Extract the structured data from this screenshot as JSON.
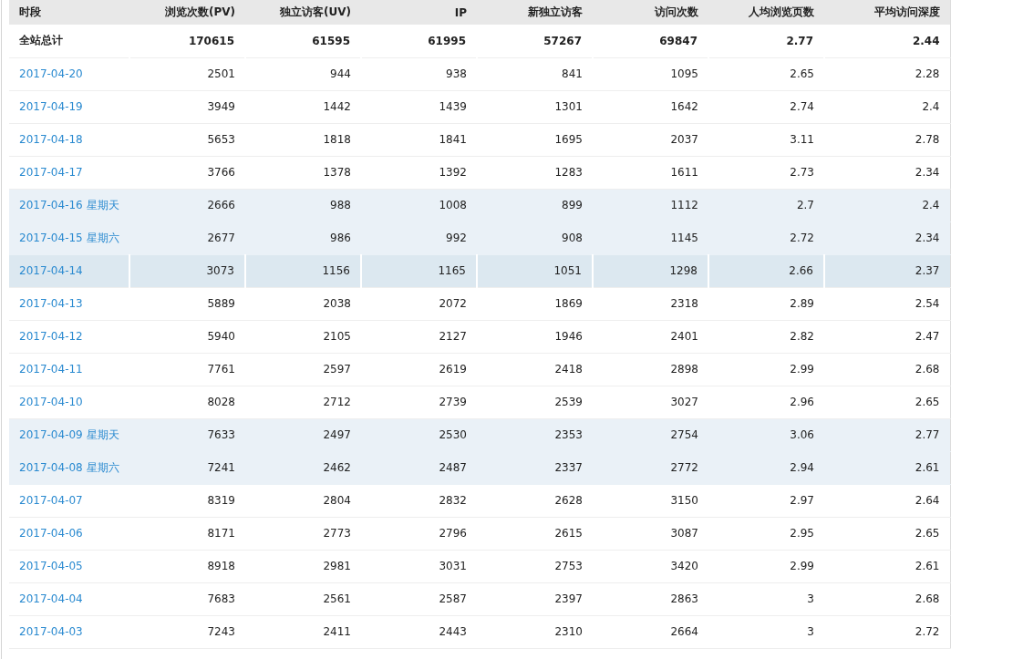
{
  "table": {
    "columns": [
      "时段",
      "浏览次数(PV)",
      "独立访客(UV)",
      "IP",
      "新独立访客",
      "访问次数",
      "人均浏览页数",
      "平均访问深度"
    ],
    "rows": [
      {
        "kind": "total",
        "label": "全站总计",
        "weekend": false,
        "selected": false,
        "values": [
          "170615",
          "61595",
          "61995",
          "57267",
          "69847",
          "2.77",
          "2.44"
        ]
      },
      {
        "kind": "day",
        "label": "2017-04-20",
        "weekend": false,
        "selected": false,
        "values": [
          "2501",
          "944",
          "938",
          "841",
          "1095",
          "2.65",
          "2.28"
        ]
      },
      {
        "kind": "day",
        "label": "2017-04-19",
        "weekend": false,
        "selected": false,
        "values": [
          "3949",
          "1442",
          "1439",
          "1301",
          "1642",
          "2.74",
          "2.4"
        ]
      },
      {
        "kind": "day",
        "label": "2017-04-18",
        "weekend": false,
        "selected": false,
        "values": [
          "5653",
          "1818",
          "1841",
          "1695",
          "2037",
          "3.11",
          "2.78"
        ]
      },
      {
        "kind": "day",
        "label": "2017-04-17",
        "weekend": false,
        "selected": false,
        "values": [
          "3766",
          "1378",
          "1392",
          "1283",
          "1611",
          "2.73",
          "2.34"
        ]
      },
      {
        "kind": "day",
        "label": "2017-04-16",
        "weekday": "星期天",
        "weekend": true,
        "selected": false,
        "values": [
          "2666",
          "988",
          "1008",
          "899",
          "1112",
          "2.7",
          "2.4"
        ]
      },
      {
        "kind": "day",
        "label": "2017-04-15",
        "weekday": "星期六",
        "weekend": true,
        "selected": false,
        "values": [
          "2677",
          "986",
          "992",
          "908",
          "1145",
          "2.72",
          "2.34"
        ]
      },
      {
        "kind": "day",
        "label": "2017-04-14",
        "weekend": false,
        "selected": true,
        "values": [
          "3073",
          "1156",
          "1165",
          "1051",
          "1298",
          "2.66",
          "2.37"
        ]
      },
      {
        "kind": "day",
        "label": "2017-04-13",
        "weekend": false,
        "selected": false,
        "values": [
          "5889",
          "2038",
          "2072",
          "1869",
          "2318",
          "2.89",
          "2.54"
        ]
      },
      {
        "kind": "day",
        "label": "2017-04-12",
        "weekend": false,
        "selected": false,
        "values": [
          "5940",
          "2105",
          "2127",
          "1946",
          "2401",
          "2.82",
          "2.47"
        ]
      },
      {
        "kind": "day",
        "label": "2017-04-11",
        "weekend": false,
        "selected": false,
        "values": [
          "7761",
          "2597",
          "2619",
          "2418",
          "2898",
          "2.99",
          "2.68"
        ]
      },
      {
        "kind": "day",
        "label": "2017-04-10",
        "weekend": false,
        "selected": false,
        "values": [
          "8028",
          "2712",
          "2739",
          "2539",
          "3027",
          "2.96",
          "2.65"
        ]
      },
      {
        "kind": "day",
        "label": "2017-04-09",
        "weekday": "星期天",
        "weekend": true,
        "selected": false,
        "values": [
          "7633",
          "2497",
          "2530",
          "2353",
          "2754",
          "3.06",
          "2.77"
        ]
      },
      {
        "kind": "day",
        "label": "2017-04-08",
        "weekday": "星期六",
        "weekend": true,
        "selected": false,
        "values": [
          "7241",
          "2462",
          "2487",
          "2337",
          "2772",
          "2.94",
          "2.61"
        ]
      },
      {
        "kind": "day",
        "label": "2017-04-07",
        "weekend": false,
        "selected": false,
        "values": [
          "8319",
          "2804",
          "2832",
          "2628",
          "3150",
          "2.97",
          "2.64"
        ]
      },
      {
        "kind": "day",
        "label": "2017-04-06",
        "weekend": false,
        "selected": false,
        "values": [
          "8171",
          "2773",
          "2796",
          "2615",
          "3087",
          "2.95",
          "2.65"
        ]
      },
      {
        "kind": "day",
        "label": "2017-04-05",
        "weekend": false,
        "selected": false,
        "values": [
          "8918",
          "2981",
          "3031",
          "2753",
          "3420",
          "2.99",
          "2.61"
        ]
      },
      {
        "kind": "day",
        "label": "2017-04-04",
        "weekend": false,
        "selected": false,
        "values": [
          "7683",
          "2561",
          "2587",
          "2397",
          "2863",
          "3",
          "2.68"
        ]
      },
      {
        "kind": "day",
        "label": "2017-04-03",
        "weekend": false,
        "selected": false,
        "values": [
          "7243",
          "2411",
          "2443",
          "2310",
          "2664",
          "3",
          "2.72"
        ]
      }
    ]
  }
}
